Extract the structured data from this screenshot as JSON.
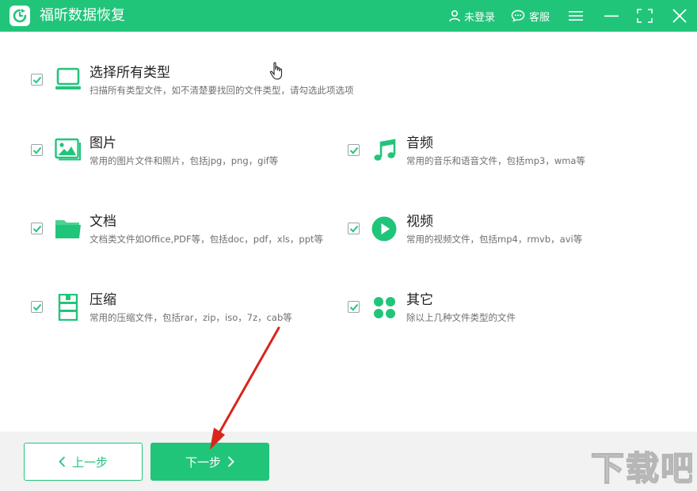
{
  "window": {
    "title": "福昕数据恢复",
    "login_label": "未登录",
    "service_label": "客服"
  },
  "options": {
    "all": {
      "title": "选择所有类型",
      "desc": "扫描所有类型文件，如不清楚要找回的文件类型，请勾选此项选项",
      "checked": true
    },
    "picture": {
      "title": "图片",
      "desc": "常用的图片文件和照片，包括jpg，png，gif等",
      "checked": true
    },
    "audio": {
      "title": "音频",
      "desc": "常用的音乐和语音文件，包括mp3，wma等",
      "checked": true
    },
    "document": {
      "title": "文档",
      "desc": "文档类文件如Office,PDF等，包括doc，pdf，xls，ppt等",
      "checked": true
    },
    "video": {
      "title": "视频",
      "desc": "常用的视频文件，包括mp4，rmvb，avi等",
      "checked": true
    },
    "archive": {
      "title": "压缩",
      "desc": "常用的压缩文件，包括rar，zip，iso，7z，cab等",
      "checked": true
    },
    "other": {
      "title": "其它",
      "desc": "除以上几种文件类型的文件",
      "checked": true
    }
  },
  "footer": {
    "prev_label": "上一步",
    "next_label": "下一步"
  },
  "watermark": {
    "text": "下载吧"
  },
  "colors": {
    "accent": "#21c57a",
    "annotation_arrow": "#d9251c"
  },
  "icons": {
    "window": [
      "app-logo-icon",
      "user-icon",
      "chat-icon",
      "menu-icon",
      "minimize-icon",
      "maximize-icon",
      "close-icon"
    ],
    "types": [
      "computer-icon",
      "picture-icon",
      "music-note-icon",
      "folder-icon",
      "play-icon",
      "archive-icon",
      "apps-icon"
    ]
  }
}
